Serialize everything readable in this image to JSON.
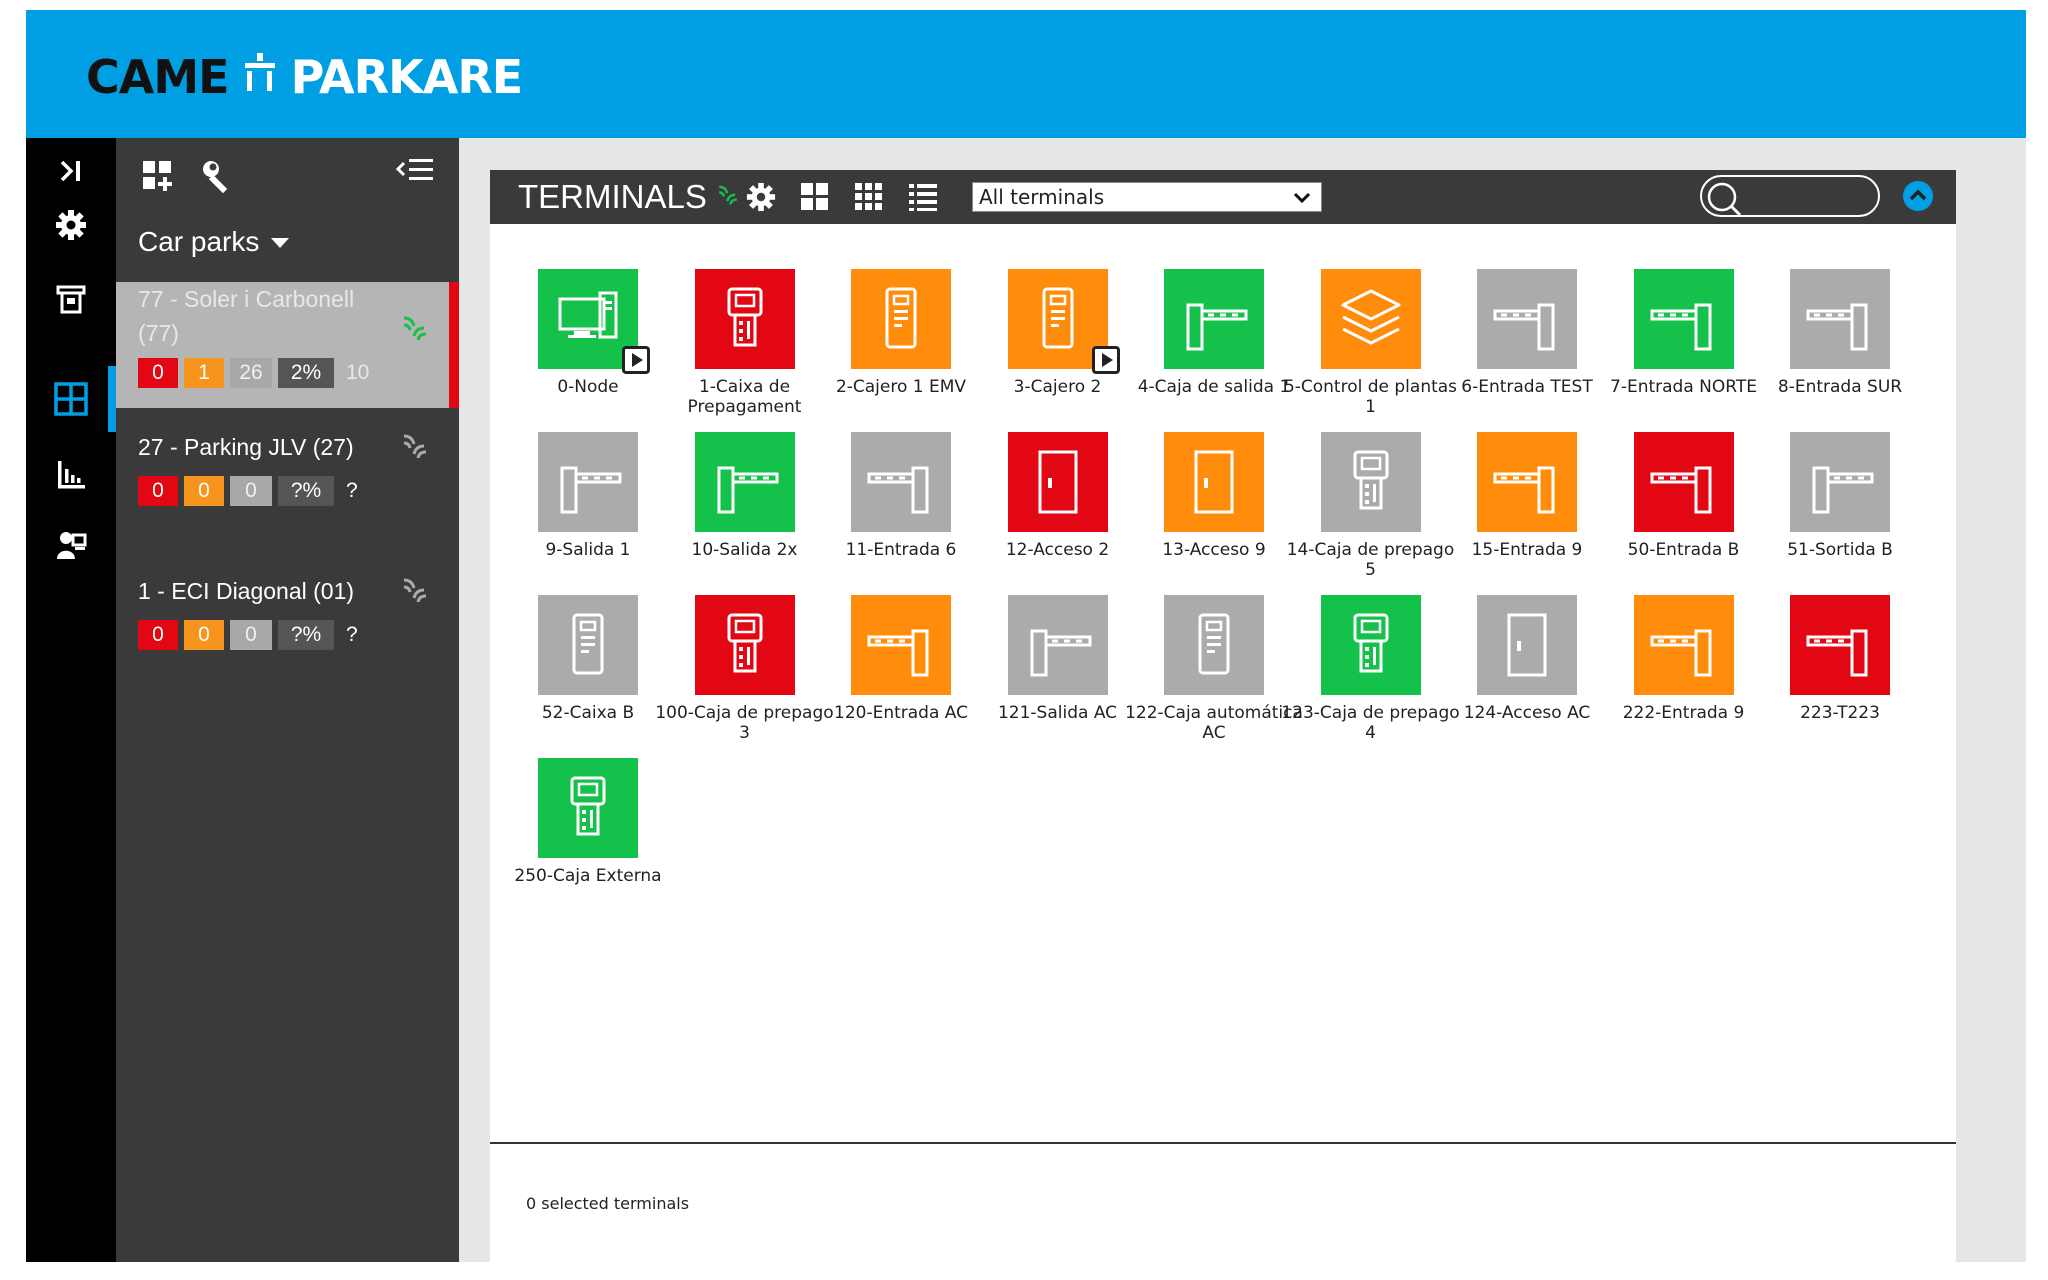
{
  "header": {
    "logo_left": "CAME",
    "logo_right": "PARKARE",
    "brand_color": "#009fe3"
  },
  "rail": {
    "icons": [
      "expand-icon",
      "gear-icon",
      "ticket-machine-icon",
      "grid-icon",
      "bar-chart-icon",
      "user-desk-icon"
    ],
    "active": "grid-icon"
  },
  "panel": {
    "title": "Car parks",
    "carparks": [
      {
        "name": "77 - Soler i Carbonell (77)",
        "red": "0",
        "orange": "1",
        "grey": "26",
        "pct": "2%",
        "count": "10",
        "selected": true,
        "online": true
      },
      {
        "name": "27 - Parking JLV (27)",
        "red": "0",
        "orange": "0",
        "grey": "0",
        "pct": "?%",
        "count": "?",
        "selected": false,
        "online": false
      },
      {
        "name": "1 - ECI Diagonal (01)",
        "red": "0",
        "orange": "0",
        "grey": "0",
        "pct": "?%",
        "count": "?",
        "selected": false,
        "online": false
      }
    ]
  },
  "toolbar": {
    "title": "TERMINALS",
    "filter_value": "All terminals",
    "search_placeholder": ""
  },
  "terminals": [
    {
      "label": "0-Node",
      "color": "green",
      "icon": "node-icon",
      "play": true
    },
    {
      "label": "1-Caixa de Prepagament",
      "color": "red",
      "icon": "pay-station-icon",
      "play": false
    },
    {
      "label": "2-Cajero 1 EMV",
      "color": "orange",
      "icon": "cashier-icon",
      "play": false
    },
    {
      "label": "3-Cajero 2",
      "color": "orange",
      "icon": "cashier-icon",
      "play": true
    },
    {
      "label": "4-Caja de salida 1",
      "color": "green",
      "icon": "exit-barrier-icon",
      "play": false
    },
    {
      "label": "5-Control de plantas 1",
      "color": "orange",
      "icon": "layers-icon",
      "play": false
    },
    {
      "label": "6-Entrada TEST",
      "color": "grey",
      "icon": "entry-barrier-icon",
      "play": false
    },
    {
      "label": "7-Entrada NORTE",
      "color": "green",
      "icon": "entry-barrier-icon",
      "play": false
    },
    {
      "label": "8-Entrada SUR",
      "color": "grey",
      "icon": "entry-barrier-icon",
      "play": false
    },
    {
      "label": "9-Salida 1",
      "color": "grey",
      "icon": "exit-barrier-icon",
      "play": false
    },
    {
      "label": "10-Salida 2x",
      "color": "green",
      "icon": "exit-barrier-icon",
      "play": false
    },
    {
      "label": "11-Entrada 6",
      "color": "grey",
      "icon": "entry-barrier-icon",
      "play": false
    },
    {
      "label": "12-Acceso 2",
      "color": "red",
      "icon": "door-icon",
      "play": false
    },
    {
      "label": "13-Acceso 9",
      "color": "orange",
      "icon": "door-icon",
      "play": false
    },
    {
      "label": "14-Caja de prepago 5",
      "color": "grey",
      "icon": "pay-station-icon",
      "play": false
    },
    {
      "label": "15-Entrada 9",
      "color": "orange",
      "icon": "entry-barrier-icon",
      "play": false
    },
    {
      "label": "50-Entrada B",
      "color": "red",
      "icon": "entry-barrier-icon",
      "play": false
    },
    {
      "label": "51-Sortida B",
      "color": "grey",
      "icon": "exit-barrier-icon",
      "play": false
    },
    {
      "label": "52-Caixa B",
      "color": "grey",
      "icon": "cashier-icon",
      "play": false
    },
    {
      "label": "100-Caja de prepago 3",
      "color": "red",
      "icon": "pay-station-icon",
      "play": false
    },
    {
      "label": "120-Entrada AC",
      "color": "orange",
      "icon": "entry-barrier-icon",
      "play": false
    },
    {
      "label": "121-Salida AC",
      "color": "grey",
      "icon": "exit-barrier-icon",
      "play": false
    },
    {
      "label": "122-Caja automática AC",
      "color": "grey",
      "icon": "cashier-icon",
      "play": false
    },
    {
      "label": "123-Caja de prepago 4",
      "color": "green",
      "icon": "pay-station-icon",
      "play": false
    },
    {
      "label": "124-Acceso AC",
      "color": "grey",
      "icon": "door-icon",
      "play": false
    },
    {
      "label": "222-Entrada 9",
      "color": "orange",
      "icon": "entry-barrier-icon",
      "play": false
    },
    {
      "label": "223-T223",
      "color": "red",
      "icon": "entry-barrier-icon",
      "play": false
    },
    {
      "label": "250-Caja Externa",
      "color": "green",
      "icon": "pay-station-icon",
      "play": false
    }
  ],
  "footer": {
    "selected": "0 selected terminals"
  },
  "colors": {
    "green": "#14c14a",
    "red": "#e30613",
    "orange": "#ff8c0a",
    "grey": "#ababab"
  }
}
